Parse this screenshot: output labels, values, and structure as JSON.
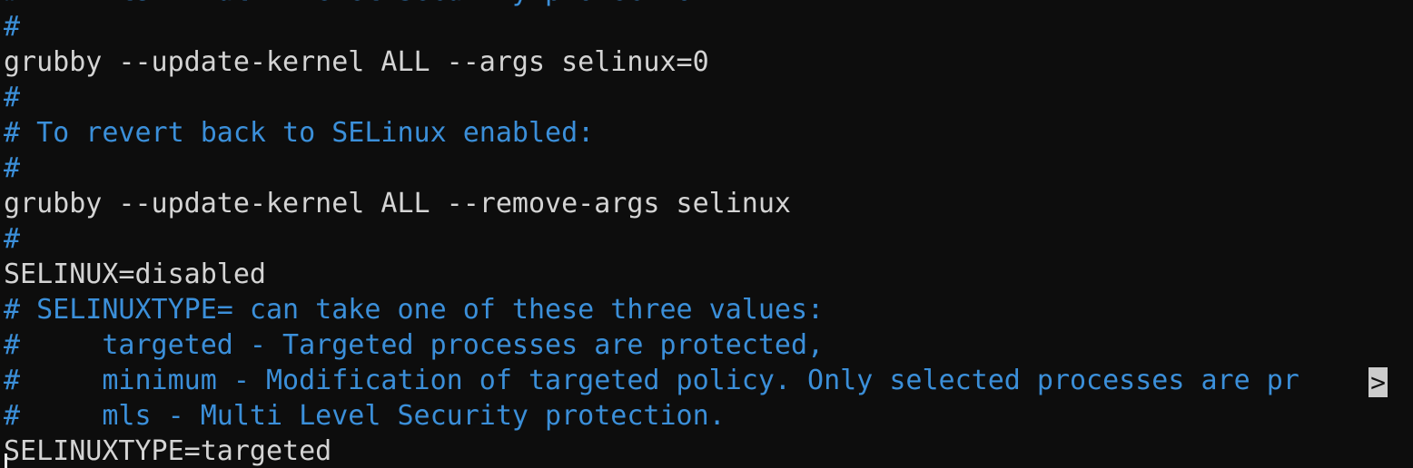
{
  "terminal": {
    "background_color": "#0d0d0d",
    "normal_text_color": "#d4d4d4",
    "comment_text_color": "#3b8fd9",
    "continuation_marker_bg": "#cccccc",
    "cursor_color": "#e8e8e8",
    "continuation_marker": ">",
    "lines": [
      {
        "text": "#     mls - Multi Level Security protection.",
        "style": "comment",
        "truncated": false
      },
      {
        "text": "#",
        "style": "comment",
        "truncated": false
      },
      {
        "text": "grubby --update-kernel ALL --args selinux=0",
        "style": "normal",
        "truncated": false
      },
      {
        "text": "#",
        "style": "comment",
        "truncated": false
      },
      {
        "text": "# To revert back to SELinux enabled:",
        "style": "comment",
        "truncated": false
      },
      {
        "text": "#",
        "style": "comment",
        "truncated": false
      },
      {
        "text": "grubby --update-kernel ALL --remove-args selinux",
        "style": "normal",
        "truncated": false
      },
      {
        "text": "#",
        "style": "comment",
        "truncated": false
      },
      {
        "text": "SELINUX=disabled",
        "style": "normal",
        "truncated": false
      },
      {
        "text": "# SELINUXTYPE= can take one of these three values:",
        "style": "comment",
        "truncated": false
      },
      {
        "text": "#     targeted - Targeted processes are protected,",
        "style": "comment",
        "truncated": false
      },
      {
        "text": "#     minimum - Modification of targeted policy. Only selected processes are pr",
        "style": "comment",
        "truncated": true
      },
      {
        "text": "#     mls - Multi Level Security protection.",
        "style": "comment",
        "truncated": false
      },
      {
        "text": "SELINUXTYPE=targeted",
        "style": "normal",
        "truncated": false
      }
    ]
  }
}
